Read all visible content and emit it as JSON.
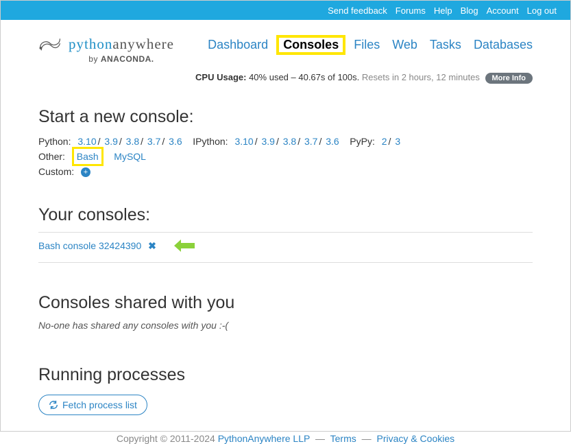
{
  "topbar": {
    "send_feedback": "Send feedback",
    "forums": "Forums",
    "help": "Help",
    "blog": "Blog",
    "account": "Account",
    "logout": "Log out"
  },
  "logo": {
    "python": "python",
    "anywhere": "anywhere",
    "byline_prefix": "by ",
    "byline_brand": "ANACONDA."
  },
  "nav": {
    "dashboard": "Dashboard",
    "consoles": "Consoles",
    "files": "Files",
    "web": "Web",
    "tasks": "Tasks",
    "databases": "Databases"
  },
  "usage": {
    "label": "CPU Usage:",
    "value": "40% used – 40.67s of 100s.",
    "reset": "Resets in 2 hours, 12 minutes",
    "more": "More Info"
  },
  "sections": {
    "start": "Start a new console:",
    "yours": "Your consoles:",
    "shared": "Consoles shared with you",
    "running": "Running processes"
  },
  "python": {
    "label": "Python:",
    "versions": [
      "3.10",
      "3.9",
      "3.8",
      "3.7",
      "3.6"
    ]
  },
  "ipython": {
    "label": "IPython:",
    "versions": [
      "3.10",
      "3.9",
      "3.8",
      "3.7",
      "3.6"
    ]
  },
  "pypy": {
    "label": "PyPy:",
    "versions": [
      "2",
      "3"
    ]
  },
  "other": {
    "label": "Other:",
    "bash": "Bash",
    "mysql": "MySQL"
  },
  "custom": {
    "label": "Custom:"
  },
  "your_console": {
    "name": "Bash console 32424390"
  },
  "shared_empty": "No-one has shared any consoles with you :-(",
  "fetch": "Fetch process list",
  "footer": {
    "copyright": "Copyright © 2011-2024",
    "company": "PythonAnywhere LLP",
    "terms": "Terms",
    "privacy": "Privacy & Cookies"
  }
}
